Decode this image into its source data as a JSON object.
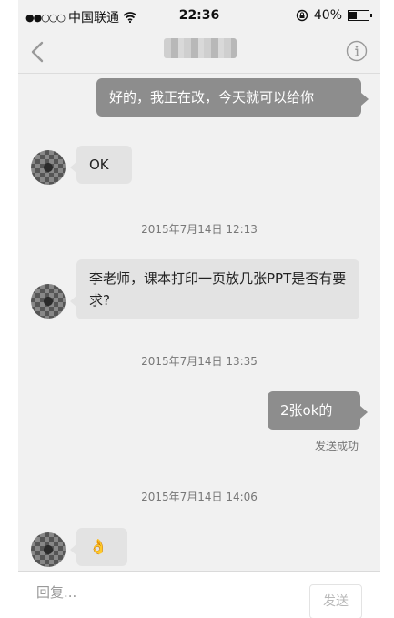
{
  "status": {
    "carrier": "中国联通",
    "time": "22:36",
    "battery": "40%",
    "battery_level": 0.4
  },
  "nav": {
    "title": "■·■·■"
  },
  "messages": [
    {
      "dir": "out",
      "text": "好的，我正在改，今天就可以给你"
    },
    {
      "dir": "in",
      "text": "OK"
    },
    {
      "dir": "in",
      "text": "李老师，课本打印一页放几张PPT是否有要求?"
    },
    {
      "dir": "out",
      "text": "2张ok的"
    },
    {
      "dir": "in",
      "text": "👌"
    }
  ],
  "timestamps": [
    "2015年7月14日  12:13",
    "2015年7月14日  13:35",
    "2015年7月14日  14:06"
  ],
  "delivery_status": "发送成功",
  "composer": {
    "placeholder": "回复...",
    "send_label": "发送"
  }
}
